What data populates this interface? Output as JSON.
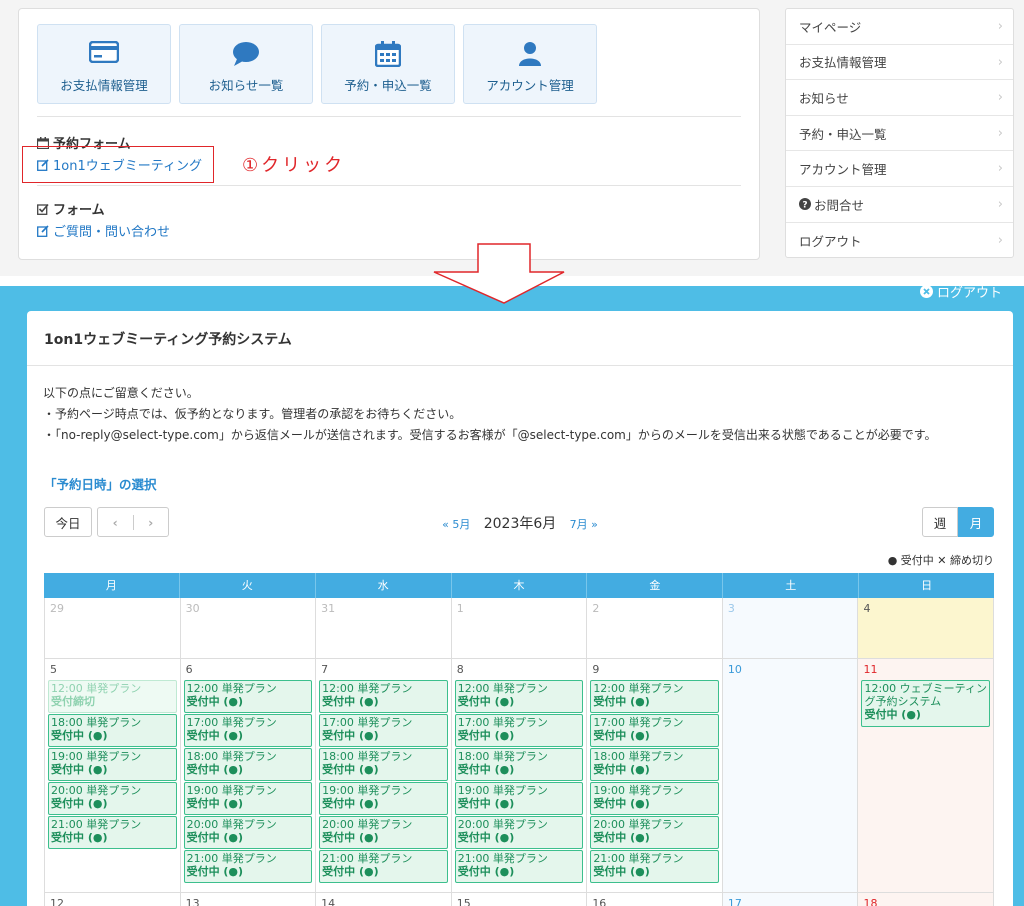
{
  "top": {
    "tiles": [
      {
        "label": "お支払情報管理",
        "icon": "credit-card-icon"
      },
      {
        "label": "お知らせ一覧",
        "icon": "comment-icon"
      },
      {
        "label": "予約・申込一覧",
        "icon": "calendar-icon"
      },
      {
        "label": "アカウント管理",
        "icon": "user-icon"
      }
    ],
    "reserve_section_title": "予約フォーム",
    "reserve_link": "1on1ウェブミーティング",
    "click_note": "①クリック",
    "form_section_title": "フォーム",
    "form_link": "ご質問・問い合わせ"
  },
  "side_menu": {
    "items": [
      "マイページ",
      "お支払情報管理",
      "お知らせ",
      "予約・申込一覧",
      "アカウント管理",
      "お問合せ",
      "ログアウト"
    ]
  },
  "header": {
    "logout": "ログアウト"
  },
  "card": {
    "title": "1on1ウェブミーティング予約システム",
    "notes": [
      "以下の点にご留意ください。",
      "・予約ページ時点では、仮予約となります。管理者の承認をお待ちください。",
      "・「no-reply@select-type.com」から返信メールが送信されます。受信するお客様が「@select-type.com」からのメールを受信出来る状態であることが必要です。"
    ],
    "selection_title": "「予約日時」の選択",
    "today": "今日",
    "prev_month": "5月",
    "current_month": "2023年6月",
    "next_month": "7月",
    "view_week": "週",
    "view_month": "月",
    "legend": "● 受付中 ✕ 締め切り"
  },
  "calendar": {
    "weekdays": [
      "月",
      "火",
      "水",
      "木",
      "金",
      "土",
      "日"
    ],
    "weeks": [
      {
        "days": [
          {
            "num": "29",
            "events": []
          },
          {
            "num": "30",
            "events": []
          },
          {
            "num": "31",
            "events": []
          },
          {
            "num": "1",
            "events": []
          },
          {
            "num": "2",
            "events": []
          },
          {
            "num": "3",
            "events": []
          },
          {
            "num": "4",
            "events": []
          }
        ]
      },
      {
        "days": [
          {
            "num": "5",
            "events": [
              {
                "time": "12:00 単発プラン",
                "status": "受付締切"
              },
              {
                "time": "18:00 単発プラン",
                "status": "受付中 (●)"
              },
              {
                "time": "19:00 単発プラン",
                "status": "受付中 (●)"
              },
              {
                "time": "20:00 単発プラン",
                "status": "受付中 (●)"
              },
              {
                "time": "21:00 単発プラン",
                "status": "受付中 (●)"
              }
            ]
          },
          {
            "num": "6",
            "events": [
              {
                "time": "12:00 単発プラン",
                "status": "受付中 (●)"
              },
              {
                "time": "17:00 単発プラン",
                "status": "受付中 (●)"
              },
              {
                "time": "18:00 単発プラン",
                "status": "受付中 (●)"
              },
              {
                "time": "19:00 単発プラン",
                "status": "受付中 (●)"
              },
              {
                "time": "20:00 単発プラン",
                "status": "受付中 (●)"
              },
              {
                "time": "21:00 単発プラン",
                "status": "受付中 (●)"
              }
            ]
          },
          {
            "num": "7",
            "events": [
              {
                "time": "12:00 単発プラン",
                "status": "受付中 (●)"
              },
              {
                "time": "17:00 単発プラン",
                "status": "受付中 (●)"
              },
              {
                "time": "18:00 単発プラン",
                "status": "受付中 (●)"
              },
              {
                "time": "19:00 単発プラン",
                "status": "受付中 (●)"
              },
              {
                "time": "20:00 単発プラン",
                "status": "受付中 (●)"
              },
              {
                "time": "21:00 単発プラン",
                "status": "受付中 (●)"
              }
            ]
          },
          {
            "num": "8",
            "events": [
              {
                "time": "12:00 単発プラン",
                "status": "受付中 (●)"
              },
              {
                "time": "17:00 単発プラン",
                "status": "受付中 (●)"
              },
              {
                "time": "18:00 単発プラン",
                "status": "受付中 (●)"
              },
              {
                "time": "19:00 単発プラン",
                "status": "受付中 (●)"
              },
              {
                "time": "20:00 単発プラン",
                "status": "受付中 (●)"
              },
              {
                "time": "21:00 単発プラン",
                "status": "受付中 (●)"
              }
            ]
          },
          {
            "num": "9",
            "events": [
              {
                "time": "12:00 単発プラン",
                "status": "受付中 (●)"
              },
              {
                "time": "17:00 単発プラン",
                "status": "受付中 (●)"
              },
              {
                "time": "18:00 単発プラン",
                "status": "受付中 (●)"
              },
              {
                "time": "19:00 単発プラン",
                "status": "受付中 (●)"
              },
              {
                "time": "20:00 単発プラン",
                "status": "受付中 (●)"
              },
              {
                "time": "21:00 単発プラン",
                "status": "受付中 (●)"
              }
            ]
          },
          {
            "num": "10",
            "events": []
          },
          {
            "num": "11",
            "events": [
              {
                "time": "12:00 ウェブミーティング予約システム",
                "status": "受付中 (●)"
              }
            ]
          }
        ]
      },
      {
        "days": [
          {
            "num": "12",
            "events": []
          },
          {
            "num": "13",
            "events": []
          },
          {
            "num": "14",
            "events": []
          },
          {
            "num": "15",
            "events": []
          },
          {
            "num": "16",
            "events": []
          },
          {
            "num": "17",
            "events": []
          },
          {
            "num": "18",
            "events": []
          }
        ]
      }
    ]
  },
  "colors": {
    "accent_blue": "#4ebde6",
    "header_blue": "#43ace1",
    "link_blue": "#2278c5",
    "highlight_red": "#e0262a",
    "event_green": "#3cbf8d",
    "today_yellow": "#fcf6cf"
  }
}
